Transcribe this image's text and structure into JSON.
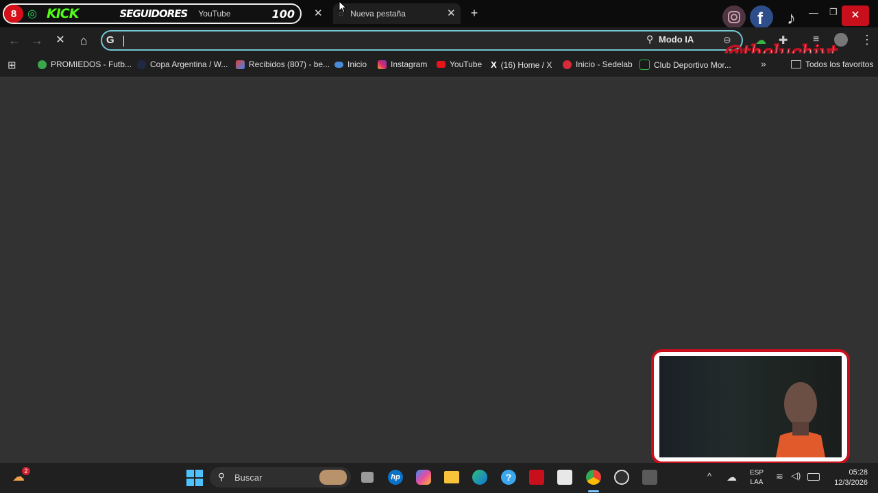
{
  "tabs": {
    "active_overlay": {
      "badge": "8",
      "kick": "KICK",
      "seguidores": "SEGUIDORES",
      "title": "YouTube",
      "count": "100"
    },
    "new_tab": {
      "title": "Nueva pestaña"
    },
    "new_tab_button": "+"
  },
  "toolbar": {
    "back": "←",
    "forward": "→",
    "stop": "✕",
    "home": "⌂",
    "omnibox_icon": "G",
    "omnibox_value": "",
    "modo_ia": "Modo IA",
    "menu": "⋮"
  },
  "bookmarks": [
    {
      "label": "PROMIEDOS - Futb...",
      "icon": "promiedos-icon",
      "color": "#3aa84a"
    },
    {
      "label": "Copa Argentina / W...",
      "icon": "copa-icon",
      "color": "#1e2a44"
    },
    {
      "label": "Recibidos (807) - be...",
      "icon": "gmail-icon",
      "color": "#e14134"
    },
    {
      "label": "Inicio",
      "icon": "cloud-icon",
      "color": "#4a8bd8"
    },
    {
      "label": "Instagram",
      "icon": "instagram-icon",
      "color": "#d6286f"
    },
    {
      "label": "YouTube",
      "icon": "youtube-icon",
      "color": "#e8141b"
    },
    {
      "label": "(16) Home / X",
      "icon": "x-icon",
      "color": "#ffffff"
    },
    {
      "label": "Inicio - Sedelab",
      "icon": "sedelab-icon",
      "color": "#d92a3a"
    },
    {
      "label": "Club Deportivo Mor...",
      "icon": "club-icon",
      "color": "#2bb44a"
    }
  ],
  "bookmarks_more": "»",
  "all_favorites": "Todos los favoritos",
  "watermark": "@theluchiyt",
  "taskbar": {
    "weather_badge": "2",
    "search_label": "Buscar",
    "lang_line1": "ESP",
    "lang_line2": "LAA",
    "time": "05:28",
    "date": "12/3/2026"
  },
  "colors": {
    "accent_red": "#c8101c",
    "kick_green": "#53fc18",
    "omnibox_border": "#74c7d4",
    "page_bg": "#323232"
  }
}
